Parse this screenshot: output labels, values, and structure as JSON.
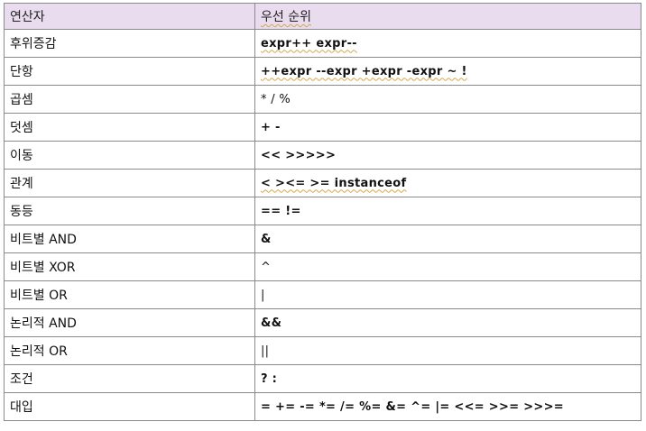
{
  "table": {
    "headers": [
      "연산자",
      "우선 순위"
    ],
    "rows": [
      {
        "operator": "후위증감",
        "precedence": "expr++ expr--"
      },
      {
        "operator": "단항",
        "precedence": "++expr --expr +expr -expr ~ !"
      },
      {
        "operator": "곱셈",
        "precedence": "* / %"
      },
      {
        "operator": "덧셈",
        "precedence": "+ -"
      },
      {
        "operator": "이동",
        "precedence": "<< >>>>>"
      },
      {
        "operator": "관계",
        "precedence": "< ><= >= instanceof"
      },
      {
        "operator": "동등",
        "precedence": "== !="
      },
      {
        "operator": "비트별 AND",
        "precedence": "&"
      },
      {
        "operator": "비트별 XOR",
        "precedence": "^"
      },
      {
        "operator": "비트별 OR",
        "precedence": "|"
      },
      {
        "operator": "논리적 AND",
        "precedence": "&&"
      },
      {
        "operator": "논리적 OR",
        "precedence": "||"
      },
      {
        "operator": "조건",
        "precedence": "? :"
      },
      {
        "operator": "대입",
        "precedence": "= += -= *= /= %= &= ^= |= <<= >>= >>>="
      }
    ]
  },
  "colors": {
    "header_background": "#e9dcef",
    "border": "#8a8a8a",
    "spellcheck_underline": "#d6a84a"
  }
}
